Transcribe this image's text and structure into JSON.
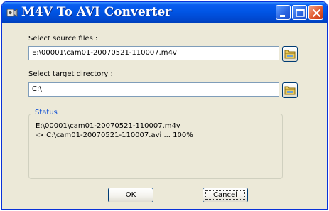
{
  "window": {
    "title": "M4V To AVI Converter",
    "icon": "app-icon",
    "controls": [
      "minimize-icon",
      "maximize-icon",
      "close-icon"
    ]
  },
  "source": {
    "label": "Select source files :",
    "value": "E:\\00001\\cam01-20070521-110007.m4v",
    "browse_icon": "folder-icon"
  },
  "target": {
    "label": "Select target directory :",
    "value": "C:\\",
    "browse_icon": "folder-icon"
  },
  "status": {
    "title": "Status",
    "lines": [
      "E:\\00001\\cam01-20070521-110007.m4v",
      "-> C:\\cam01-20070521-110007.avi ... 100%"
    ]
  },
  "buttons": {
    "ok": "OK",
    "cancel": "Cancel"
  },
  "colors": {
    "titlebar": "#0055e5",
    "window_bg": "#ece9d8",
    "status_title": "#0046d5",
    "close_button": "#e25a2f"
  }
}
